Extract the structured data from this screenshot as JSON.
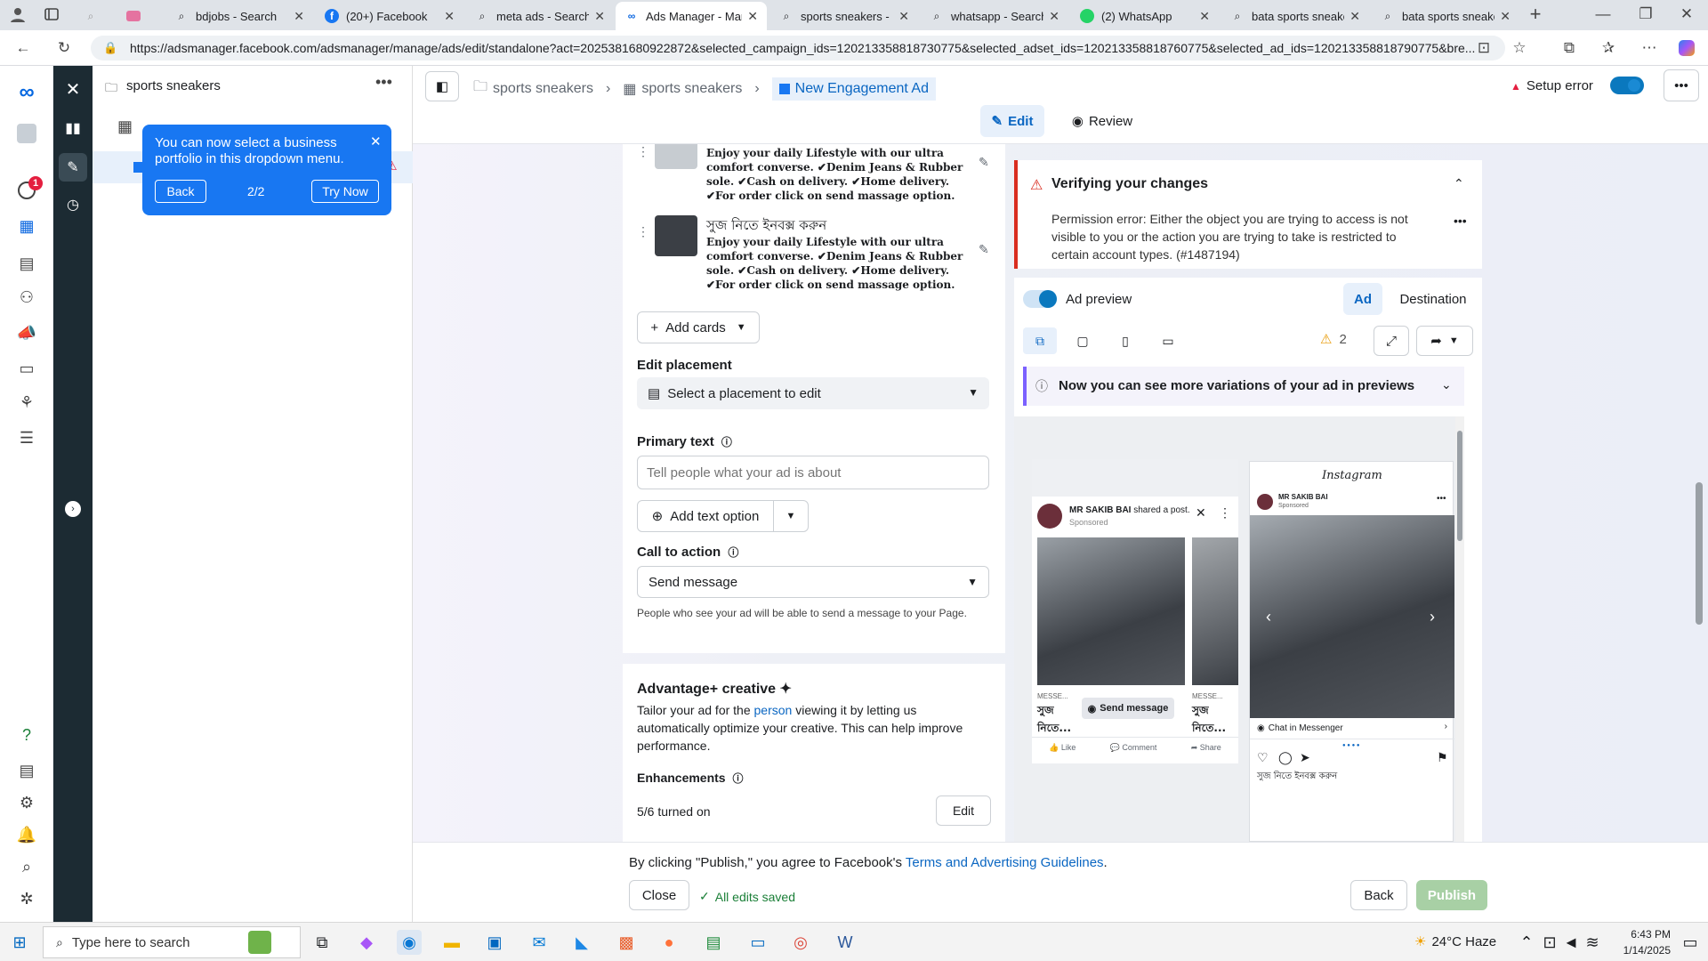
{
  "browser": {
    "tabs": [
      {
        "label": "",
        "icon": "search-icon"
      },
      {
        "label": "",
        "icon": "video-icon"
      },
      {
        "label": "bdjobs - Search",
        "icon": "search-icon"
      },
      {
        "label": "(20+) Facebook",
        "icon": "facebook-icon"
      },
      {
        "label": "meta ads - Search",
        "icon": "search-icon"
      },
      {
        "label": "Ads Manager - Man",
        "icon": "meta-icon"
      },
      {
        "label": "sports sneakers - Se",
        "icon": "search-icon"
      },
      {
        "label": "whatsapp - Search",
        "icon": "search-icon"
      },
      {
        "label": "(2) WhatsApp",
        "icon": "whatsapp-icon"
      },
      {
        "label": "bata sports sneaker",
        "icon": "search-icon"
      },
      {
        "label": "bata sports sneakers",
        "icon": "search-icon"
      }
    ],
    "url": "https://adsmanager.facebook.com/adsmanager/manage/ads/edit/standalone?act=2025381680922872&selected_campaign_ids=120213358818730775&selected_adset_ids=120213358818760775&selected_ad_ids=120213358818790775&bre..."
  },
  "rail": {
    "notification_count": "1"
  },
  "campaign_panel": {
    "title": "sports sneakers",
    "tooltip_text": "You can now select a business portfolio in this dropdown menu.",
    "tooltip_back": "Back",
    "tooltip_step": "2/2",
    "tooltip_try": "Try Now"
  },
  "topnav": {
    "breadcrumb": [
      "sports sneakers",
      "sports sneakers",
      "New Engagement Ad"
    ],
    "status": "Setup error",
    "edit_label": "Edit",
    "review_label": "Review"
  },
  "cards": [
    {
      "title": "",
      "text": "Enjoy your daily Lifestyle with our ultra comfort converse. ✔Denim Jeans & Rubber sole. ✔Cash on delivery. ✔Home delivery. ✔For order click on send massage option."
    },
    {
      "title": "সুজ নিতে ইনবক্স করুন",
      "text": "Enjoy your daily Lifestyle with our ultra comfort converse. ✔Denim Jeans & Rubber sole. ✔Cash on delivery. ✔Home delivery. ✔For order click on send massage option."
    }
  ],
  "editor": {
    "add_cards": "Add cards",
    "edit_placement_label": "Edit placement",
    "placement_select": "Select a placement to edit",
    "primary_text_label": "Primary text",
    "primary_text_placeholder": "Tell people what your ad is about",
    "add_text_option": "Add text option",
    "cta_label": "Call to action",
    "cta_value": "Send message",
    "cta_help": "People who see your ad will be able to send a message to your Page.",
    "advantage_title": "Advantage+ creative",
    "advantage_desc_1": "Tailor your ad for the",
    "advantage_link": "person",
    "advantage_desc_2": "viewing it by letting us automatically optimize your creative. This can help improve performance.",
    "enhancements_label": "Enhancements",
    "enhancements_value": "5/6 turned on",
    "enhancements_edit": "Edit"
  },
  "preview": {
    "verify_title": "Verifying your changes",
    "verify_error": "Permission error: Either the object you are trying to access is not visible to you or the action you are trying to take is restricted to certain account types. (#1487194)",
    "ad_preview_label": "Ad preview",
    "ad_tab": "Ad",
    "destination_tab": "Destination",
    "warning_count": "2",
    "variations_banner": "Now you can see more variations of your ad in previews",
    "fb_page_name": "MR SAKIB BAI",
    "fb_shared": "shared a post.",
    "fb_sponsored": "Sponsored",
    "fb_card_label_1": "MESSE...",
    "fb_card_title_1": "সুজ নিতে...",
    "fb_send_message": "Send message",
    "fb_card_label_2": "MESSE...",
    "fb_card_title_2": "সুজ নিতে...",
    "fb_like": "Like",
    "fb_comment": "Comment",
    "fb_share": "Share",
    "ig_brand": "Instagram",
    "ig_page_name": "MR SAKIB BAI",
    "ig_sponsored": "Sponsored",
    "ig_chat": "Chat in Messenger",
    "ig_caption": "সুজ নিতে ইনবক্স করুন"
  },
  "footer": {
    "agree_prefix": "By clicking \"Publish,\" you agree to Facebook's",
    "agree_link": "Terms and Advertising Guidelines",
    "agree_suffix": ".",
    "close": "Close",
    "saved": "All edits saved",
    "back": "Back",
    "publish": "Publish"
  },
  "taskbar": {
    "search_placeholder": "Type here to search",
    "weather": "24°C Haze",
    "time": "6:43 PM",
    "date": "1/14/2025"
  },
  "colors": {
    "accent": "#0a78be",
    "dark_rail": "#1c2b33",
    "error": "#d92d20",
    "tooltip": "#1877f2"
  }
}
